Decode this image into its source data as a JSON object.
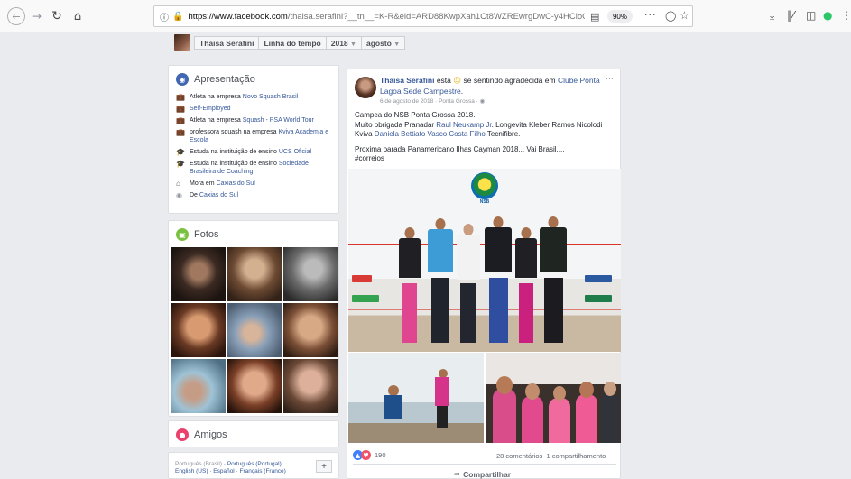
{
  "browser": {
    "url_domain": "https://www.facebook.com",
    "url_path": "/thaisa.serafini?__tn__=K-R&eid=ARD88KwpXah1Ct8WZREwrgDwC-y4HCloO",
    "zoom": "90%",
    "page_actions": "···"
  },
  "profile_bar": {
    "name": "Thaisa Serafini",
    "timeline": "Linha do tempo",
    "year": "2018",
    "month": "agosto"
  },
  "intro": {
    "title": "Apresentação",
    "items": [
      {
        "prefix": "Atleta na empresa ",
        "link": "Novo Squash Brasil"
      },
      {
        "prefix": "",
        "link": "Self-Employed"
      },
      {
        "prefix": "Atleta na empresa ",
        "link": "Squash - PSA World Tour"
      },
      {
        "prefix": "professora squash na empresa ",
        "link": "Kviva Academia e Escola"
      },
      {
        "prefix": "Estuda na instituição de ensino ",
        "link": "UCS Oficial"
      },
      {
        "prefix": "Estuda na instituição de ensino ",
        "link": "Sociedade Brasileira de Coaching"
      },
      {
        "prefix": "Mora em ",
        "link": "Caxias do Sul"
      },
      {
        "prefix": "De ",
        "link": "Caxias do Sul"
      }
    ]
  },
  "photos": {
    "title": "Fotos"
  },
  "friends": {
    "title": "Amigos"
  },
  "languages": {
    "current": "Português (Brasil)",
    "others": [
      "Português (Portugal)",
      "English (US)",
      "Español",
      "Français (France)"
    ],
    "add_label": "+"
  },
  "post": {
    "author": "Thaisa Serafini",
    "feeling_text": " está ",
    "feeling_emoji": "☺",
    "feeling_rest": " se sentindo agradecida em ",
    "place": "Clube Ponta Lagoa Sede Campestre",
    "place_suffix": ".",
    "date": "6 de agosto de 2018",
    "location": "Ponta Grossa",
    "more": "···",
    "line1": "Campea do NSB Ponta Grossa 2018.",
    "line2_prefix": "Muito obrigada Pranadar ",
    "tag1": "Raul Neukamp Jr",
    "line2_mid": ". Longevita Kleber Ramos Nicolodi Kviva ",
    "tag2": "Daniela Bettiato",
    "tag3": "Vasco Costa Filho",
    "line2_suffix": " Tecnifibre.",
    "line3": "Proxima parada Panamericano Ilhas Cayman 2018... Vai Brasil....",
    "hashtag": "#correios",
    "photo_logo": "NSB",
    "reactions_count": "190",
    "comments": "28 comentários",
    "shares": "1 compartilhamento",
    "share_label": "Compartilhar"
  }
}
